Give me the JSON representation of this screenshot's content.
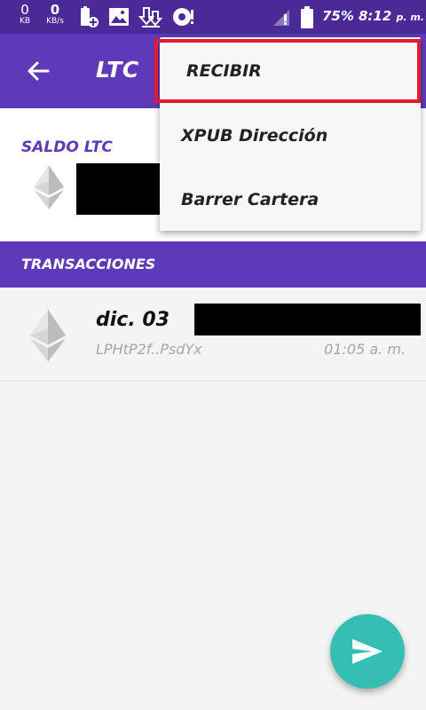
{
  "status_bar": {
    "net1_value": "0",
    "net1_unit": "KB",
    "net2_value": "0",
    "net2_unit": "KB/s",
    "battery": "75%",
    "time": "8:12",
    "ampm": "p. m.",
    "icons": [
      "battery-plus-icon",
      "image-icon",
      "download-icon",
      "sync-alert-icon",
      "signal-icon",
      "battery-icon"
    ]
  },
  "app_bar": {
    "title": "LTC",
    "back_icon": "arrow-left-icon"
  },
  "balance": {
    "label": "SALDO LTC",
    "icon": "ethereum-icon"
  },
  "transactions": {
    "header": "TRANSACCIONES",
    "items": [
      {
        "date": "dic. 03",
        "address": "LPHtP2f..PsdYx",
        "time": "01:05 a. m."
      }
    ]
  },
  "menu": {
    "items": [
      "RECIBIR",
      "XPUB Dirección",
      "Barrer Cartera"
    ],
    "highlighted_index": 0
  },
  "fab": {
    "icon": "send-icon"
  },
  "colors": {
    "status_bar": "#4a2a96",
    "primary": "#5e3ab8",
    "accent": "#35bfb2",
    "highlight": "#e21c2e"
  }
}
